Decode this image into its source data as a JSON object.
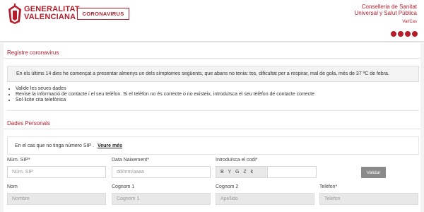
{
  "header": {
    "brand_line1": "GENERALITAT",
    "brand_line2": "VALENCIANA",
    "badge": "CORONAVIRUS",
    "conselleria_line1": "Conselleria de Sanitat",
    "conselleria_line2": "Universal y Salut Pública",
    "language": "Val/Cas",
    "social_icons": [
      "youtube-icon",
      "twitter-icon",
      "instagram-icon",
      "flickr-icon"
    ],
    "accent_color": "#b51d2b"
  },
  "registre": {
    "title": "Registre coronavirus",
    "notice": "En els últims 14 dies he començat a presentar almenys un dels símptomes següents, que abans no tenia: tos, dificultat per a respirar, mal de gola, més de 37 ºC de febra.",
    "steps": [
      "Valide les seues dades",
      "Revise la informació de contacte i el seu telèfon. Si el telèfon no és correcte o no existeix, introduïsca el seu telèfon de contacte correcte",
      "Sol·licite cita telefònica"
    ]
  },
  "dades": {
    "title": "Dades Personals",
    "sip_note": "En el cas que no tinga número SIP .",
    "sip_link": "Veure més",
    "fields": {
      "sip_label": "Núm. SIP*",
      "sip_placeholder": "Núm. SIP",
      "birth_label": "Data Naixement*",
      "birth_placeholder": "dd/mm/aaaa",
      "code_label": "Introduïsca el codi*",
      "captcha_text": "B Y G Z k",
      "validate_button": "Validar",
      "name_label": "Nom",
      "name_placeholder": "Nombre",
      "surname1_label": "Cognom 1",
      "surname1_placeholder": "Cognom 1",
      "surname2_label": "Cognom 2",
      "surname2_placeholder": "Apellido",
      "phone_label": "Telèfon*",
      "phone_placeholder": "Telefon"
    }
  }
}
